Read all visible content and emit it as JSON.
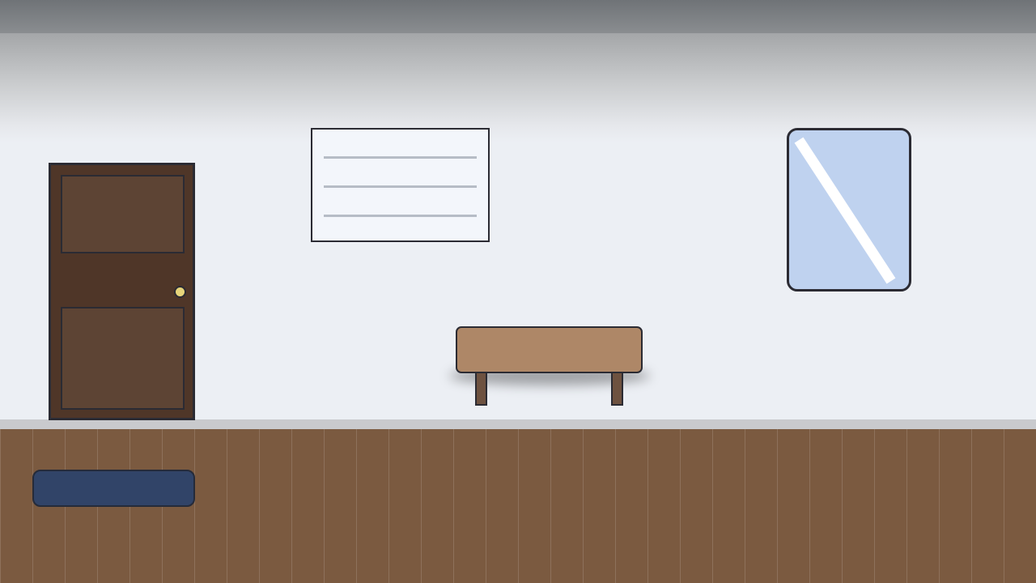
{
  "scene": {
    "name": "hallway-room",
    "colors": {
      "wall": "#eceff4",
      "ceiling": "#7b7e82",
      "baseboard": "#c9cacd",
      "floor": "#7b5a40",
      "door": "#4f3628",
      "door_panel": "#5d4434",
      "door_knob": "#e7d57a",
      "board": "#f3f6fb",
      "board_lines": "#b6bcc6",
      "mirror": "#bfd2ef",
      "bench_top": "#ae8767",
      "bench_legs": "#6e5240",
      "rug": "#314468",
      "outline": "#2b2b33"
    },
    "objects": [
      "door",
      "notice-board",
      "mirror",
      "bench",
      "rug"
    ]
  }
}
